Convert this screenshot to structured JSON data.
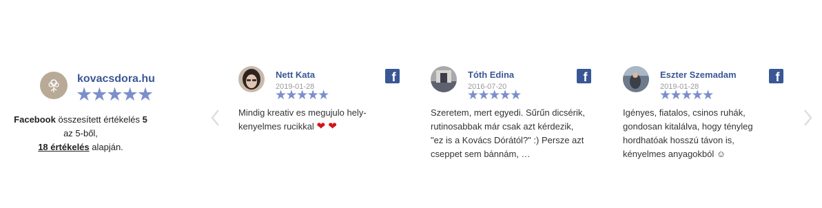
{
  "colors": {
    "accent": "#3a5795",
    "star": "#7b8fcb",
    "date": "#999999",
    "heart": "#d0161c"
  },
  "summary": {
    "name": "kovacsdora.hu",
    "stars": "★★★★★",
    "source": "Facebook",
    "text_before": " összesített értékelés ",
    "rating": "5",
    "text_after": " az 5-ből,",
    "count": "18 értékelés",
    "basis": " alapján."
  },
  "reviews": [
    {
      "name": "Nett Kata",
      "date": "2019-01-28",
      "stars": "★★★★★",
      "text": "Mindig kreativ es megujulo hely- kenyelmes rucikkal",
      "hearts": "❤ ❤",
      "icon": "facebook-icon"
    },
    {
      "name": "Tóth Edina",
      "date": "2016-07-20",
      "stars": "★★★★★",
      "text": "Szeretem, mert egyedi. Sűrűn dicsérik, rutinosabbak már csak azt kérdezik, \"ez is a Kovács Dórától?\" :) Persze azt cseppet sem bánnám, …",
      "icon": "facebook-icon"
    },
    {
      "name": "Eszter Szemadam",
      "date": "2019-01-28",
      "stars": "★★★★★",
      "text": "Igényes, fiatalos, csinos ruhák, gondosan kitalálva, hogy tényleg hordhatóak hosszú távon is, kényelmes anyagokból ☺",
      "icon": "facebook-icon"
    }
  ]
}
